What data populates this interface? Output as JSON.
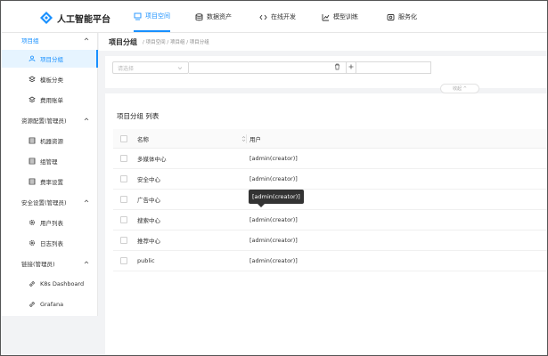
{
  "app": {
    "title": "人工智能平台",
    "nav": [
      {
        "label": "项目空间",
        "icon": "project-icon",
        "active": true
      },
      {
        "label": "数据资产",
        "icon": "database-icon",
        "active": false
      },
      {
        "label": "在线开发",
        "icon": "code-icon",
        "active": false
      },
      {
        "label": "模型训练",
        "icon": "training-icon",
        "active": false
      },
      {
        "label": "服务化",
        "icon": "service-icon",
        "active": false
      }
    ]
  },
  "sidebar": {
    "groups": [
      {
        "label": "项目组",
        "active": true,
        "items": [
          {
            "label": "项目分组",
            "icon": "group-icon",
            "active": true
          },
          {
            "label": "模板分类",
            "icon": "layers-icon",
            "active": false
          },
          {
            "label": "费用账单",
            "icon": "layers-icon",
            "active": false
          }
        ]
      },
      {
        "label": "资源配置(管理员)",
        "active": false,
        "items": [
          {
            "label": "机器资源",
            "icon": "grid-icon",
            "active": false
          },
          {
            "label": "组管理",
            "icon": "grid-icon",
            "active": false
          },
          {
            "label": "费率设置",
            "icon": "grid-icon",
            "active": false
          }
        ]
      },
      {
        "label": "安全设置(管理员)",
        "active": false,
        "items": [
          {
            "label": "用户列表",
            "icon": "gear-icon",
            "active": false
          },
          {
            "label": "日志列表",
            "icon": "gear-icon",
            "active": false
          }
        ]
      },
      {
        "label": "链接(管理员)",
        "active": false,
        "items": [
          {
            "label": "K8s Dashboard",
            "icon": "link-icon",
            "active": false
          },
          {
            "label": "Grafana",
            "icon": "link-icon",
            "active": false
          }
        ]
      }
    ]
  },
  "main": {
    "page_title": "项目分组",
    "breadcrumb": "/ 项目空间 / 项目组 / 项目分组",
    "filter": {
      "select_placeholder": "请选择",
      "input_value": "",
      "collapse_label": "收起 ^"
    },
    "list_title": "项目分组 列表",
    "columns": {
      "name": "名称",
      "user": "用户"
    },
    "rows": [
      {
        "name": "多媒体中心",
        "user": "[admin(creator)]"
      },
      {
        "name": "安全中心",
        "user": "[admin(creator)]"
      },
      {
        "name": "广告中心",
        "user": "[admin(creator)]"
      },
      {
        "name": "搜索中心",
        "user": "[admin(creator)]"
      },
      {
        "name": "推荐中心",
        "user": "[admin(creator)]"
      },
      {
        "name": "public",
        "user": "[admin(creator)]"
      }
    ],
    "tooltip": "[admin(creator)]"
  },
  "colors": {
    "accent": "#1890ff",
    "active_bg": "#e6f4ff",
    "tooltip_bg": "#333333"
  }
}
